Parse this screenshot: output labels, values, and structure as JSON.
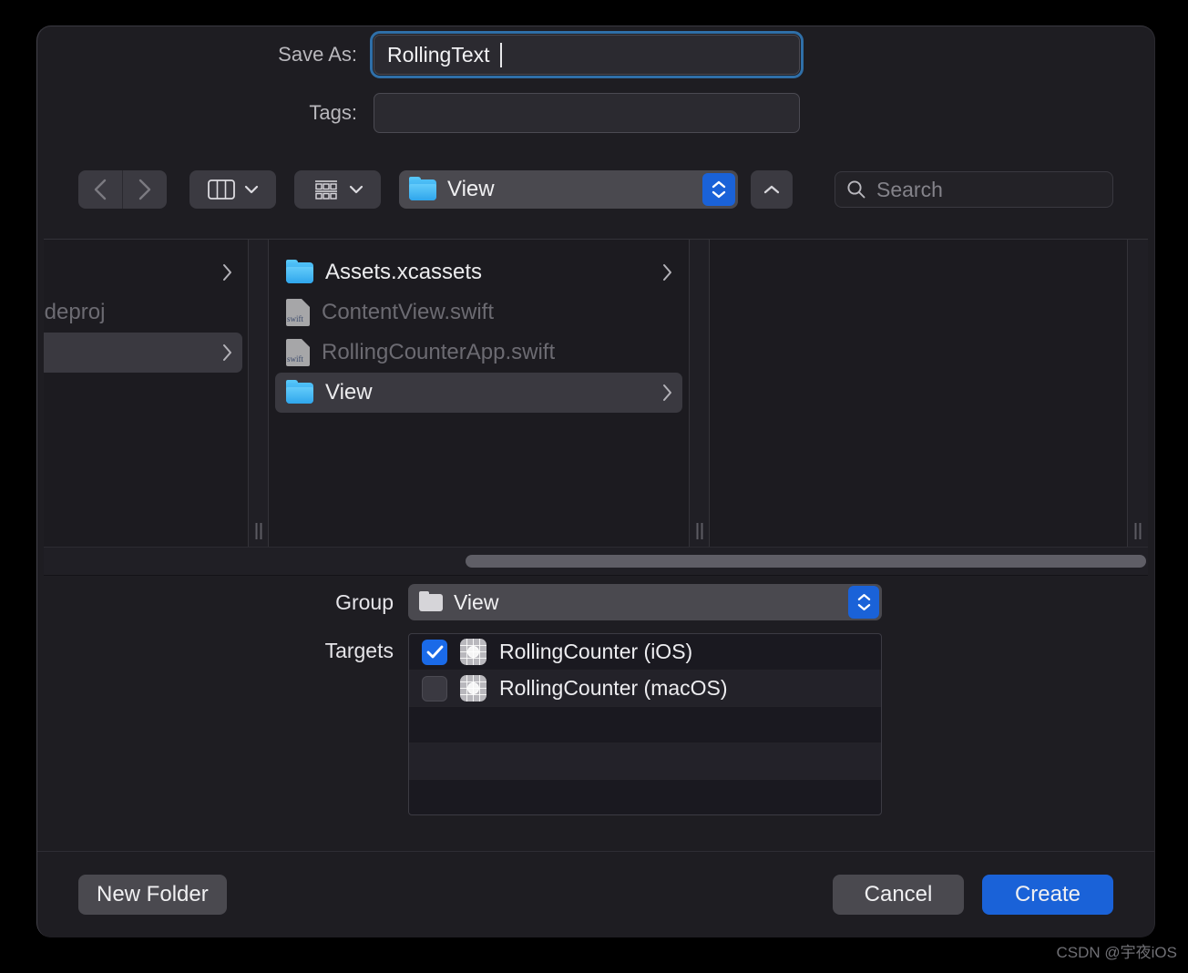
{
  "dialog": {
    "save_as_label": "Save As:",
    "save_as_value": "RollingText",
    "tags_label": "Tags:",
    "tags_value": "",
    "tags_placeholder": ""
  },
  "toolbar": {
    "back_icon": "chevron-left-icon",
    "forward_icon": "chevron-right-icon",
    "column_view_icon": "column-view-icon",
    "gallery_view_icon": "gallery-view-icon",
    "location_label": "View",
    "location_icon": "folder-icon",
    "up_icon": "chevron-up-icon",
    "search_placeholder": "Search",
    "search_value": "",
    "search_icon": "search-icon"
  },
  "browser": {
    "column0": {
      "items": [
        {
          "name": "",
          "kind": "row-truncated",
          "chevron": true,
          "selected": false
        },
        {
          "name": "r.xcodeproj",
          "kind": "truncated",
          "chevron": false,
          "selected": false
        },
        {
          "name": "",
          "kind": "row-truncated",
          "chevron": true,
          "selected": true
        }
      ]
    },
    "column2": {
      "items": [
        {
          "name": "Assets.xcassets",
          "kind": "folder",
          "chevron": true,
          "selected": false,
          "dim": false
        },
        {
          "name": "ContentView.swift",
          "kind": "swift",
          "chevron": false,
          "selected": false,
          "dim": true
        },
        {
          "name": "RollingCounterApp.swift",
          "kind": "swift",
          "chevron": false,
          "selected": false,
          "dim": true
        },
        {
          "name": "View",
          "kind": "folder",
          "chevron": true,
          "selected": true,
          "dim": false
        }
      ]
    }
  },
  "lower": {
    "group_label": "Group",
    "group_value": "View",
    "targets_label": "Targets",
    "targets": [
      {
        "name": "RollingCounter (iOS)",
        "checked": true
      },
      {
        "name": "RollingCounter (macOS)",
        "checked": false
      }
    ]
  },
  "buttons": {
    "new_folder": "New Folder",
    "cancel": "Cancel",
    "create": "Create"
  },
  "watermark": "CSDN @宇夜iOS",
  "colors": {
    "accent_blue": "#1a62d8",
    "focus_ring": "#2f6fa8",
    "sheet_bg": "#1e1d22",
    "control_gray": "#4a494f",
    "folder_blue": "#2fa6ec"
  }
}
